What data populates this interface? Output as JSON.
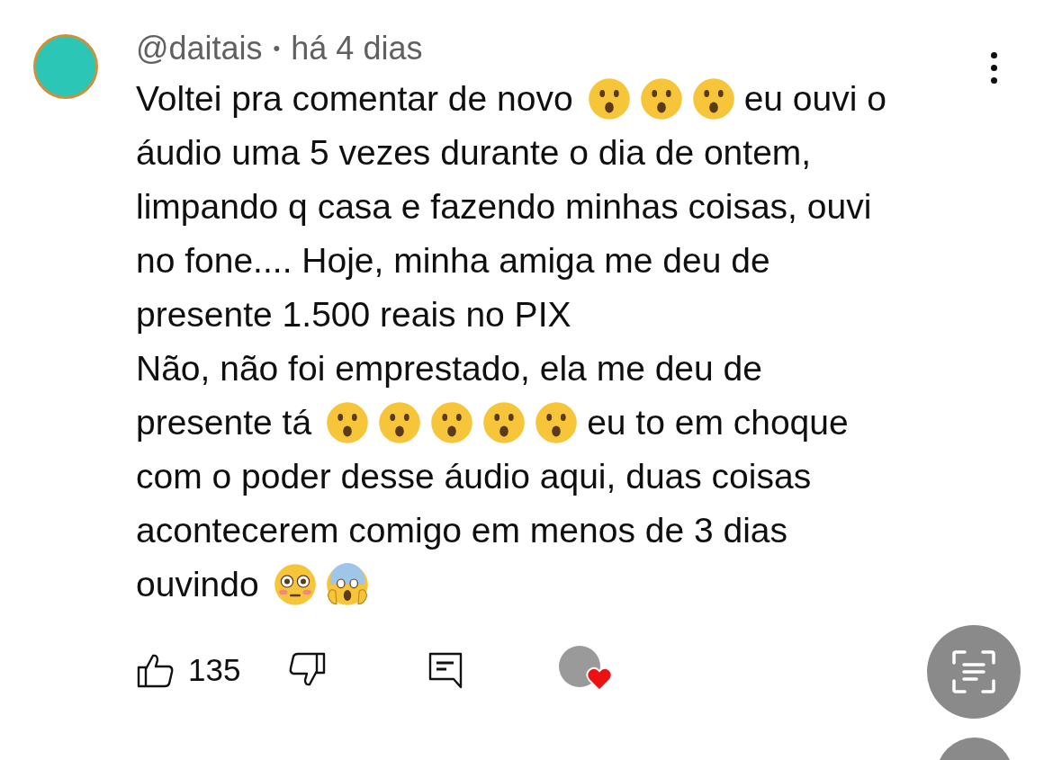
{
  "comment": {
    "author": "@daitais",
    "separator": "•",
    "time": "há 4 dias",
    "lines": [
      [
        {
          "kind": "text",
          "text": "Voltei pra comentar de novo"
        },
        {
          "kind": "surprised_emoji"
        },
        {
          "kind": "surprised_emoji"
        },
        {
          "kind": "surprised_emoji"
        },
        {
          "kind": "text",
          "text": "eu ouvi o"
        }
      ],
      [
        {
          "kind": "text",
          "text": "áudio uma 5 vezes durante o dia de ontem,"
        }
      ],
      [
        {
          "kind": "text",
          "text": "limpando q casa e fazendo minhas coisas, ouvi"
        }
      ],
      [
        {
          "kind": "text",
          "text": "no fone.... Hoje, minha amiga me deu de"
        }
      ],
      [
        {
          "kind": "text",
          "text": "presente 1.500 reais no PIX"
        }
      ],
      [
        {
          "kind": "text",
          "text": "Não, não foi emprestado, ela me deu de"
        }
      ],
      [
        {
          "kind": "text",
          "text": "presente tá"
        },
        {
          "kind": "surprised_emoji"
        },
        {
          "kind": "surprised_emoji"
        },
        {
          "kind": "surprised_emoji"
        },
        {
          "kind": "surprised_emoji"
        },
        {
          "kind": "surprised_emoji"
        },
        {
          "kind": "text",
          "text": "eu to em choque"
        }
      ],
      [
        {
          "kind": "text",
          "text": "com o poder desse áudio aqui, duas coisas"
        }
      ],
      [
        {
          "kind": "text",
          "text": "acontecerem comigo em menos de 3 dias"
        }
      ],
      [
        {
          "kind": "text",
          "text": "ouvindo"
        },
        {
          "kind": "flushed_emoji"
        },
        {
          "kind": "screaming_emoji"
        }
      ]
    ],
    "likes": "135",
    "creator_hearted": true
  }
}
